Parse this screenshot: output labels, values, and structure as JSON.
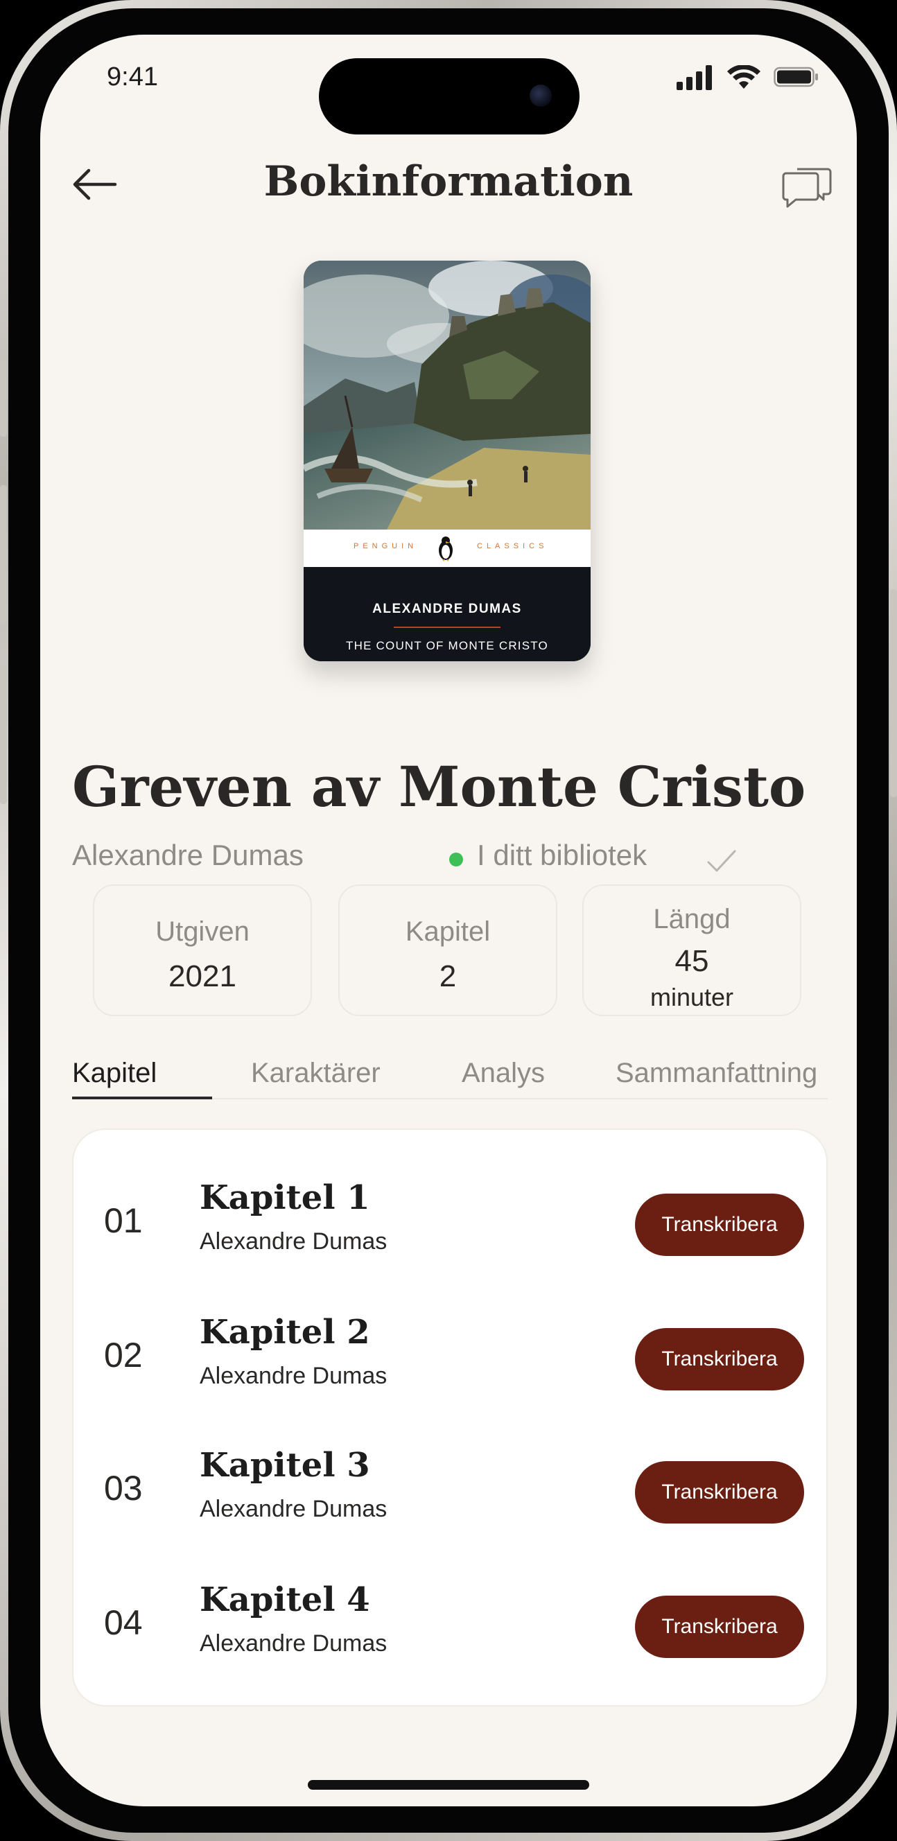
{
  "status_bar": {
    "time": "9:41"
  },
  "header": {
    "title": "Bokinformation",
    "back_icon": "arrow-left-icon",
    "chat_icon": "chat-bubbles-icon"
  },
  "cover": {
    "publisher_left": "PENGUIN",
    "publisher_right": "CLASSICS",
    "author": "ALEXANDRE DUMAS",
    "title": "THE COUNT OF MONTE CRISTO"
  },
  "book": {
    "title": "Greven av Monte Cristo",
    "author": "Alexandre Dumas",
    "library_status": "I ditt bibliotek"
  },
  "stats": [
    {
      "label": "Utgiven",
      "value": "2021"
    },
    {
      "label": "Kapitel",
      "value": "2"
    },
    {
      "label": "Längd",
      "value": "45",
      "unit": "minuter"
    }
  ],
  "tabs": [
    {
      "label": "Kapitel",
      "active": true
    },
    {
      "label": "Karaktärer"
    },
    {
      "label": "Analys"
    },
    {
      "label": "Sammanfattning"
    }
  ],
  "chapters": [
    {
      "number": "01",
      "title": "Kapitel 1",
      "author": "Alexandre Dumas",
      "action": "Transkribera"
    },
    {
      "number": "02",
      "title": "Kapitel 2",
      "author": "Alexandre Dumas",
      "action": "Transkribera"
    },
    {
      "number": "03",
      "title": "Kapitel 3",
      "author": "Alexandre Dumas",
      "action": "Transkribera"
    },
    {
      "number": "04",
      "title": "Kapitel 4",
      "author": "Alexandre Dumas",
      "action": "Transkribera"
    }
  ],
  "colors": {
    "background": "#f8f5f0",
    "accent_button": "#6b1f12",
    "status_dot": "#3fbf58",
    "text_primary": "#2a2826",
    "text_muted": "#8c8b88"
  }
}
